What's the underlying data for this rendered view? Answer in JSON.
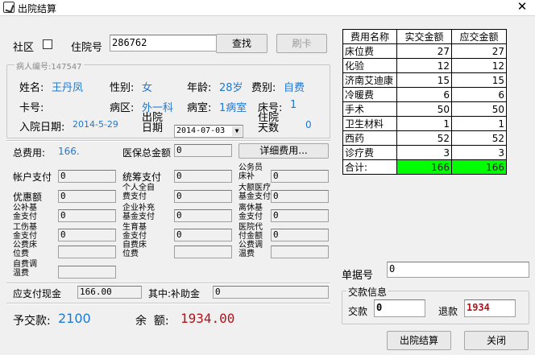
{
  "window": {
    "title": "出院结算"
  },
  "search": {
    "community_label": "社区",
    "inpatient_no_label": "住院号",
    "inpatient_no_value": "286762",
    "search_button": "查找",
    "swipe_button": "刷卡"
  },
  "patient": {
    "group_title": "病人编号:147547",
    "name_label": "姓名:",
    "name_value": "王丹凤",
    "gender_label": "性别:",
    "gender_value": "女",
    "age_label": "年龄:",
    "age_value": "28岁",
    "fee_type_label": "费别:",
    "fee_type_value": "自费",
    "card_label": "卡号:",
    "ward_label": "病区:",
    "ward_value": "外一科",
    "room_label": "病室:",
    "room_value": "1病室",
    "bed_label": "床号:",
    "bed_value": "1",
    "admit_date_label": "入院日期:",
    "admit_date_value": "2014-5-29",
    "discharge_label_1": "出院",
    "discharge_label_2": "日期",
    "discharge_date_value": "2014-07-03",
    "stay_label_1": "住院",
    "stay_label_2": "天数",
    "stay_days_value": "0"
  },
  "costs": {
    "total_label": "总费用:",
    "total_value": "166.",
    "insurance_total_label": "医保总金额",
    "insurance_total_value": "0",
    "detail_button": "详细费用...",
    "account_pay_label": "帐户支付",
    "account_pay_value": "0",
    "pooled_pay_label": "统筹支付",
    "pooled_pay_value": "0",
    "civil_servant_label_1": "公务员",
    "civil_servant_label_2": "床补",
    "civil_servant_value": "0",
    "discount_label": "优惠额",
    "discount_value": "0",
    "personal_pay_label_1": "个人全自",
    "personal_pay_label_2": "费支付",
    "personal_pay_value": "0",
    "big_medical_label_1": "大额医疗",
    "big_medical_label_2": "基金支付",
    "big_medical_value": "0",
    "public_fund_label_1": "公补基",
    "public_fund_label_2": "金支付",
    "public_fund_value": "0",
    "enterprise_label_1": "企业补充",
    "enterprise_label_2": "基金支付",
    "enterprise_value": "0",
    "retired_label_1": "离休基",
    "retired_label_2": "金支付",
    "retired_value": "0",
    "injury_label_1": "工伤基",
    "injury_label_2": "金支付",
    "injury_value": "0",
    "maternity_label_1": "生育基",
    "maternity_label_2": "金支付",
    "maternity_value": "0",
    "hospital_label_1": "医院代",
    "hospital_label_2": "付金额",
    "hospital_value": "0",
    "bed_fee_label_1": "公费床",
    "bed_fee_label_2": "位费",
    "bed_fee_value": "",
    "self_bed_label_1": "自费床",
    "self_bed_label_2": "位费",
    "self_bed_value": "",
    "public_temp_label_1": "公费调",
    "public_temp_label_2": "温费",
    "public_temp_value": "",
    "self_temp_label_1": "自费调",
    "self_temp_label_2": "温费",
    "self_temp_value": "",
    "cash_label": "应支付现金",
    "cash_value": "166.00",
    "subsidy_label": "其中:补助金",
    "subsidy_value": "0"
  },
  "summary": {
    "prepay_label": "予交款:",
    "prepay_value": "2100",
    "balance_label": "余  额:",
    "balance_value": "1934.00"
  },
  "fees_table": {
    "headers": [
      "费用名称",
      "实交金额",
      "应交金额"
    ],
    "rows": [
      [
        "床位费",
        "27",
        "27"
      ],
      [
        "化验",
        "12",
        "12"
      ],
      [
        "济南艾迪康",
        "15",
        "15"
      ],
      [
        "冷暖费",
        "6",
        "6"
      ],
      [
        "手术",
        "50",
        "50"
      ],
      [
        "卫生材料",
        "1",
        "1"
      ],
      [
        "西药",
        "52",
        "52"
      ],
      [
        "诊疗费",
        "3",
        "3"
      ]
    ],
    "total": [
      "合计:",
      "166",
      "166"
    ]
  },
  "receipt": {
    "receipt_no_label": "单据号",
    "receipt_no_value": "0",
    "payment_group_title": "交款信息",
    "payment_label": "交款",
    "payment_value": "0",
    "change_label": "退款",
    "change_value": "1934"
  },
  "actions": {
    "discharge_button": "出院结算",
    "close_button": "关闭"
  }
}
